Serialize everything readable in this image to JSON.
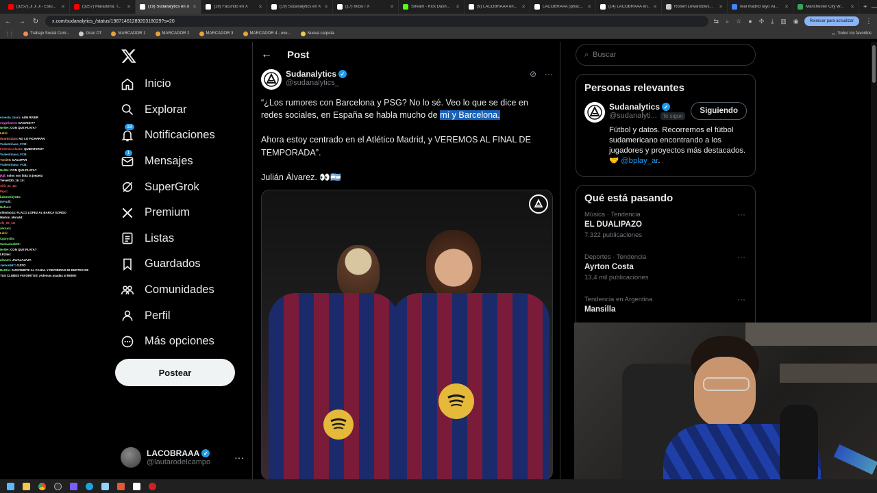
{
  "browser": {
    "tabs": [
      {
        "title": "(3257) Ji Ji Ji - Estu...",
        "color": "#ff0000",
        "active": false
      },
      {
        "title": "(3257) Maradona: T...",
        "color": "#ff0000",
        "active": false
      },
      {
        "title": "(19) Sudanalytics en X",
        "color": "#ffffff",
        "active": true
      },
      {
        "title": "(19) Facundo en X",
        "color": "#ffffff",
        "active": false
      },
      {
        "title": "(19) Sudanalytics en X",
        "color": "#ffffff",
        "active": false
      },
      {
        "title": "(17) Inicio / X",
        "color": "#ffffff",
        "active": false
      },
      {
        "title": "Stream - Kick Dash...",
        "color": "#53fc18",
        "active": false
      },
      {
        "title": "(9) LACOBRAAA en...",
        "color": "#ffffff",
        "active": false
      },
      {
        "title": "LACOBRAAA (@lac...",
        "color": "#ffffff",
        "active": false
      },
      {
        "title": "(14) LACOBRAAA en...",
        "color": "#ffffff",
        "active": false
      },
      {
        "title": "Robert Lewandows...",
        "color": "#cccccc",
        "active": false
      },
      {
        "title": "real madrid rayo va...",
        "color": "#4285f4",
        "active": false
      },
      {
        "title": "Manchester City W...",
        "color": "#34a853",
        "active": false
      }
    ],
    "url": "x.com/sudanalytics_/status/1987146128920318029?s=20",
    "update_label": "Reiniciar para actualizar",
    "bookmarks": [
      "Trabajo Social Com...",
      "Gran DT",
      "MARCADOR 1",
      "MARCADOR 2",
      "MARCADOR 3",
      "MARCADOR 4 - ove...",
      "Nueva carpeta"
    ],
    "all_bookmarks": "Todos los favoritos"
  },
  "chat": [
    {
      "user": "ernesto_tsuru",
      "color": "#7fd4ff",
      "msg": ": ADN RIVER"
    },
    {
      "user": "soyprimero",
      "color": "#ff70ff",
      "msg": ": GAGAN!!??"
    },
    {
      "user": "Nel0H",
      "color": "#7cff7c",
      "msg": ": CON QUE PLATA?"
    },
    {
      "user": "Lelzi",
      "color": "#ffd24a",
      "msg": ":"
    },
    {
      "user": "ricardo1415",
      "color": "#ff8c8c",
      "msg": ": NO LO FICHARAN"
    },
    {
      "user": "Vvalentinasa_FCB",
      "color": "#7fd4ff",
      "msg": ":"
    },
    {
      "user": "Fedeniccolazzo",
      "color": "#ff5a5a",
      "msg": ": QUIENTERO?"
    },
    {
      "user": "Vvalentinasa_FCB",
      "color": "#7fd4ff",
      "msg": ":"
    },
    {
      "user": "Tomi95",
      "color": "#ffb347",
      "msg": ": GALOPAR"
    },
    {
      "user": "Vvalentinasa_FCB",
      "color": "#7fd4ff",
      "msg": ":"
    },
    {
      "user": "Nel0H",
      "color": "#7cff7c",
      "msg": ": CON QUE PLATA?"
    },
    {
      "user": "jkjjl",
      "color": "#ff70ff",
      "msg": ": solos nos falta la joepeta"
    },
    {
      "user": "Yeivel030_19_10",
      "color": "#ffffff",
      "msg": ":"
    },
    {
      "user": "Ailit_22_12",
      "color": "#ff5a5a",
      "msg": ":"
    },
    {
      "user": "Pipu",
      "color": "#ff5a5a",
      "msg": ":"
    },
    {
      "user": "lulamosky044",
      "color": "#7cff7c",
      "msg": ":"
    },
    {
      "user": "DrPadil",
      "color": "#7fd4ff",
      "msg": ":"
    },
    {
      "user": "Nafoss",
      "color": "#7cff7c",
      "msg": ":"
    },
    {
      "user": "chimino14",
      "color": "#ffffff",
      "msg": ": FLACO LOPEZ AL BARÇA GORDO"
    },
    {
      "user": "Marlon_Mora64",
      "color": "#ffffff",
      "msg": ":"
    },
    {
      "user": "Jfs_05_10",
      "color": "#ff5a5a",
      "msg": ":"
    },
    {
      "user": "alezum",
      "color": "#7cff7c",
      "msg": ":"
    },
    {
      "user": "Lelzi",
      "color": "#ffd24a",
      "msg": ":"
    },
    {
      "user": "Cgxrycilo",
      "color": "#7cff7c",
      "msg": ":"
    },
    {
      "user": "Samuelosh22",
      "color": "#7cff7c",
      "msg": ":"
    },
    {
      "user": "Nel0H",
      "color": "#7cff7c",
      "msg": ": CON QUE PLATA?"
    },
    {
      "user": "LRZaki",
      "color": "#ffffff",
      "msg": ":"
    },
    {
      "user": "alezum",
      "color": "#7cff7c",
      "msg": ": JAJAJAJAJA"
    },
    {
      "user": "Jenton567",
      "color": "#7fd4ff",
      "msg": ": OJITO"
    },
    {
      "user": "BotRix",
      "color": "#7cff7c",
      "msg": ": SUSCRIBITE AL CANAL Y RECIBIRAS 60 EMOTES DE"
    },
    {
      "user": "TUS CLUBES FAVORITOS!",
      "color": "#ffffff",
      "msg": " ¡Ademas ayudas al NENE!"
    }
  ],
  "nav": {
    "items": [
      {
        "label": "Inicio",
        "icon": "home-icon"
      },
      {
        "label": "Explorar",
        "icon": "search-icon"
      },
      {
        "label": "Notificaciones",
        "icon": "bell-icon",
        "badge": "18"
      },
      {
        "label": "Mensajes",
        "icon": "mail-icon",
        "badge": "1"
      },
      {
        "label": "SuperGrok",
        "icon": "grok-icon"
      },
      {
        "label": "Premium",
        "icon": "x-premium-icon"
      },
      {
        "label": "Listas",
        "icon": "list-icon"
      },
      {
        "label": "Guardados",
        "icon": "bookmark-icon"
      },
      {
        "label": "Comunidades",
        "icon": "communities-icon"
      },
      {
        "label": "Perfil",
        "icon": "person-icon"
      },
      {
        "label": "Más opciones",
        "icon": "more-circle-icon"
      }
    ],
    "post_button": "Postear",
    "me": {
      "name": "LACOBRAAA",
      "handle": "@lautarodeIcampo"
    }
  },
  "post": {
    "header": "Post",
    "author_name": "Sudanalytics",
    "author_handle": "@sudanalytics_",
    "text_1_before": "“¿Los rumores con Barcelona y PSG? No lo sé. Veo lo que se dice en redes sociales, en España se habla mucho de ",
    "text_1_highlight": "mí y Barcelona.",
    "text_2": "Ahora estoy centrado en el Atlético Madrid, y VEREMOS AL FINAL DE TEMPORADA”.",
    "text_3": "Julián Álvarez. 👀🇦🇷"
  },
  "sidebar": {
    "search_placeholder": "Buscar",
    "relevant_title": "Personas relevantes",
    "relevant": {
      "name": "Sudanalytics",
      "handle": "@sudanalyti...",
      "follows_you": "Te sigue",
      "follow_label": "Siguiendo",
      "bio_text": "Fútbol y datos. Recorremos el fútbol sudamericano encontrando a los jugadores y proyectos más destacados. 🤝 ",
      "bio_link": "@bplay_ar",
      "bio_end": "."
    },
    "trends_title": "Qué está pasando",
    "trends": [
      {
        "meta": "Música · Tendencia",
        "name": "EL DUALIPAZO",
        "count": "7.322 publicaciones"
      },
      {
        "meta": "Deportes · Tendencia",
        "name": "Ayrton Costa",
        "count": "13,4 mil publicaciones"
      },
      {
        "meta": "Tendencia en Argentina",
        "name": "Mansilla",
        "count": ""
      }
    ]
  },
  "colors": {
    "accent": "#1d9bf0",
    "highlight": "#1a62b8"
  }
}
